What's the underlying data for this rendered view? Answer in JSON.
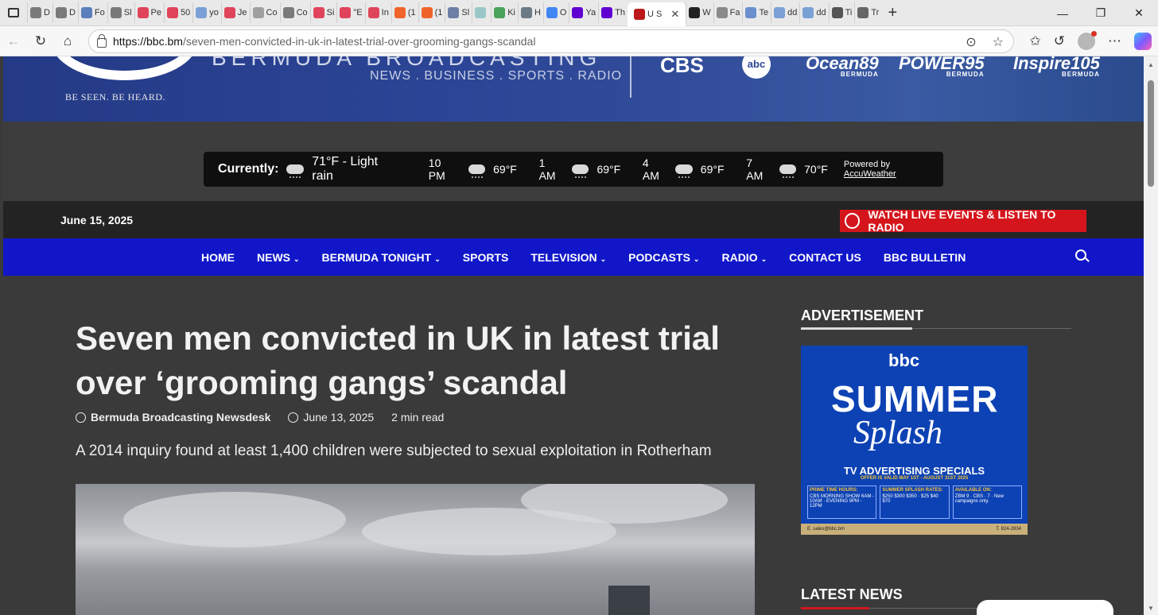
{
  "browser": {
    "tabs": [
      {
        "label": "D",
        "color": "#7a7a7a"
      },
      {
        "label": "D",
        "color": "#7a7a7a"
      },
      {
        "label": "Fo",
        "color": "#5b7fbd"
      },
      {
        "label": "Sl",
        "color": "#7a7a7a"
      },
      {
        "label": "Pe",
        "color": "#e0445a"
      },
      {
        "label": "50",
        "color": "#e0445a"
      },
      {
        "label": "yo",
        "color": "#7aa0d6"
      },
      {
        "label": "Je",
        "color": "#e0445a"
      },
      {
        "label": "Co",
        "color": "#a0a0a0"
      },
      {
        "label": "Co",
        "color": "#7a7a7a"
      },
      {
        "label": "Si",
        "color": "#e0445a"
      },
      {
        "label": "\"E",
        "color": "#e0445a"
      },
      {
        "label": "In",
        "color": "#e0445a"
      },
      {
        "label": "(1",
        "color": "#f0632a"
      },
      {
        "label": "(1",
        "color": "#f0632a"
      },
      {
        "label": "Sl",
        "color": "#6e7fa6"
      },
      {
        "label": "",
        "color": "#9ac7c7"
      },
      {
        "label": "Ki",
        "color": "#4aa35a"
      },
      {
        "label": "H",
        "color": "#6c7a86"
      },
      {
        "label": "O",
        "color": "#4285f4"
      },
      {
        "label": "Ya",
        "color": "#6001d2"
      },
      {
        "label": "Th",
        "color": "#6001d2"
      }
    ],
    "active_tab": {
      "label": "U S",
      "close": "✕"
    },
    "tabs_after": [
      {
        "label": "W",
        "color": "#222222"
      },
      {
        "label": "Fa",
        "color": "#8a8a8a"
      },
      {
        "label": "Te",
        "color": "#6a8fcf"
      },
      {
        "label": "dd",
        "color": "#7aa0d6"
      },
      {
        "label": "dd",
        "color": "#7aa0d6"
      },
      {
        "label": "Ti",
        "color": "#555555"
      },
      {
        "label": "Tr",
        "color": "#666666"
      }
    ],
    "new_tab": "+",
    "url_host": "https://bbc.bm",
    "url_path": "/seven-men-convicted-in-uk-in-latest-trial-over-grooming-gangs-scandal"
  },
  "banner": {
    "tagline": "BE SEEN. BE HEARD.",
    "brand": "BERMUDA BROADCASTING",
    "brand_sub": "NEWS . BUSINESS . SPORTS . RADIO",
    "cbs": "CBS",
    "abc": "abc",
    "partners": [
      {
        "name": "Ocean89",
        "sub": "BERMUDA"
      },
      {
        "name": "POWER95",
        "sub": "BERMUDA"
      },
      {
        "name": "Inspire105",
        "sub": "BERMUDA"
      }
    ]
  },
  "weather": {
    "current_label": "Currently:",
    "current": "71°F - Light rain",
    "forecast": [
      {
        "time": "10 PM",
        "temp": "69°F"
      },
      {
        "time": "1 AM",
        "temp": "69°F"
      },
      {
        "time": "4 AM",
        "temp": "69°F"
      },
      {
        "time": "7 AM",
        "temp": "70°F"
      }
    ],
    "powered_prefix": "Powered by",
    "powered_brand": "AccuWeather"
  },
  "datebar": {
    "date": "June 15, 2025",
    "live_button": "WATCH LIVE EVENTS & LISTEN TO RADIO"
  },
  "nav": [
    {
      "label": "HOME",
      "caret": ""
    },
    {
      "label": "NEWS",
      "caret": "⌄"
    },
    {
      "label": "BERMUDA TONIGHT",
      "caret": "⌄"
    },
    {
      "label": "SPORTS",
      "caret": ""
    },
    {
      "label": "TELEVISION",
      "caret": "⌄"
    },
    {
      "label": "PODCASTS",
      "caret": "⌄"
    },
    {
      "label": "RADIO",
      "caret": "⌄"
    },
    {
      "label": "CONTACT US",
      "caret": ""
    },
    {
      "label": "BBC BULLETIN",
      "caret": ""
    }
  ],
  "article": {
    "headline": "Seven men convicted in UK in latest trial over ‘grooming gangs’ scandal",
    "author": "Bermuda Broadcasting Newsdesk",
    "date": "June 13, 2025",
    "read_time": "2 min read",
    "subtitle": "A 2014 inquiry found at least 1,400 children were subjected to sexual exploitation in Rotherham"
  },
  "sidebar": {
    "ad_title": "ADVERTISEMENT",
    "ad": {
      "logo": "bbc",
      "summer": "SUMMER",
      "splash": "Splash",
      "tv_specials": "TV ADVERTISING SPECIALS",
      "offer": "OFFER IS VALID MAY 1ST - AUGUST 31ST 2025",
      "prime_time": "PRIME TIME HOURS:",
      "prime_time_rows": "CBS MORNING SHOW 6AM - 10AM · EVENING 9PM - 12PM",
      "rates": "SUMMER SPLASH RATES:",
      "rates_rows": "$250 $300 $350 · $25 $40 $70",
      "available": "AVAILABLE ON:",
      "available_rows": "ZBM 9 · CBS · 7 · New campaigns only.",
      "email": "E. sales@bbc.bm",
      "phone": "T. 824-2834"
    },
    "latest_title": "LATEST NEWS"
  }
}
